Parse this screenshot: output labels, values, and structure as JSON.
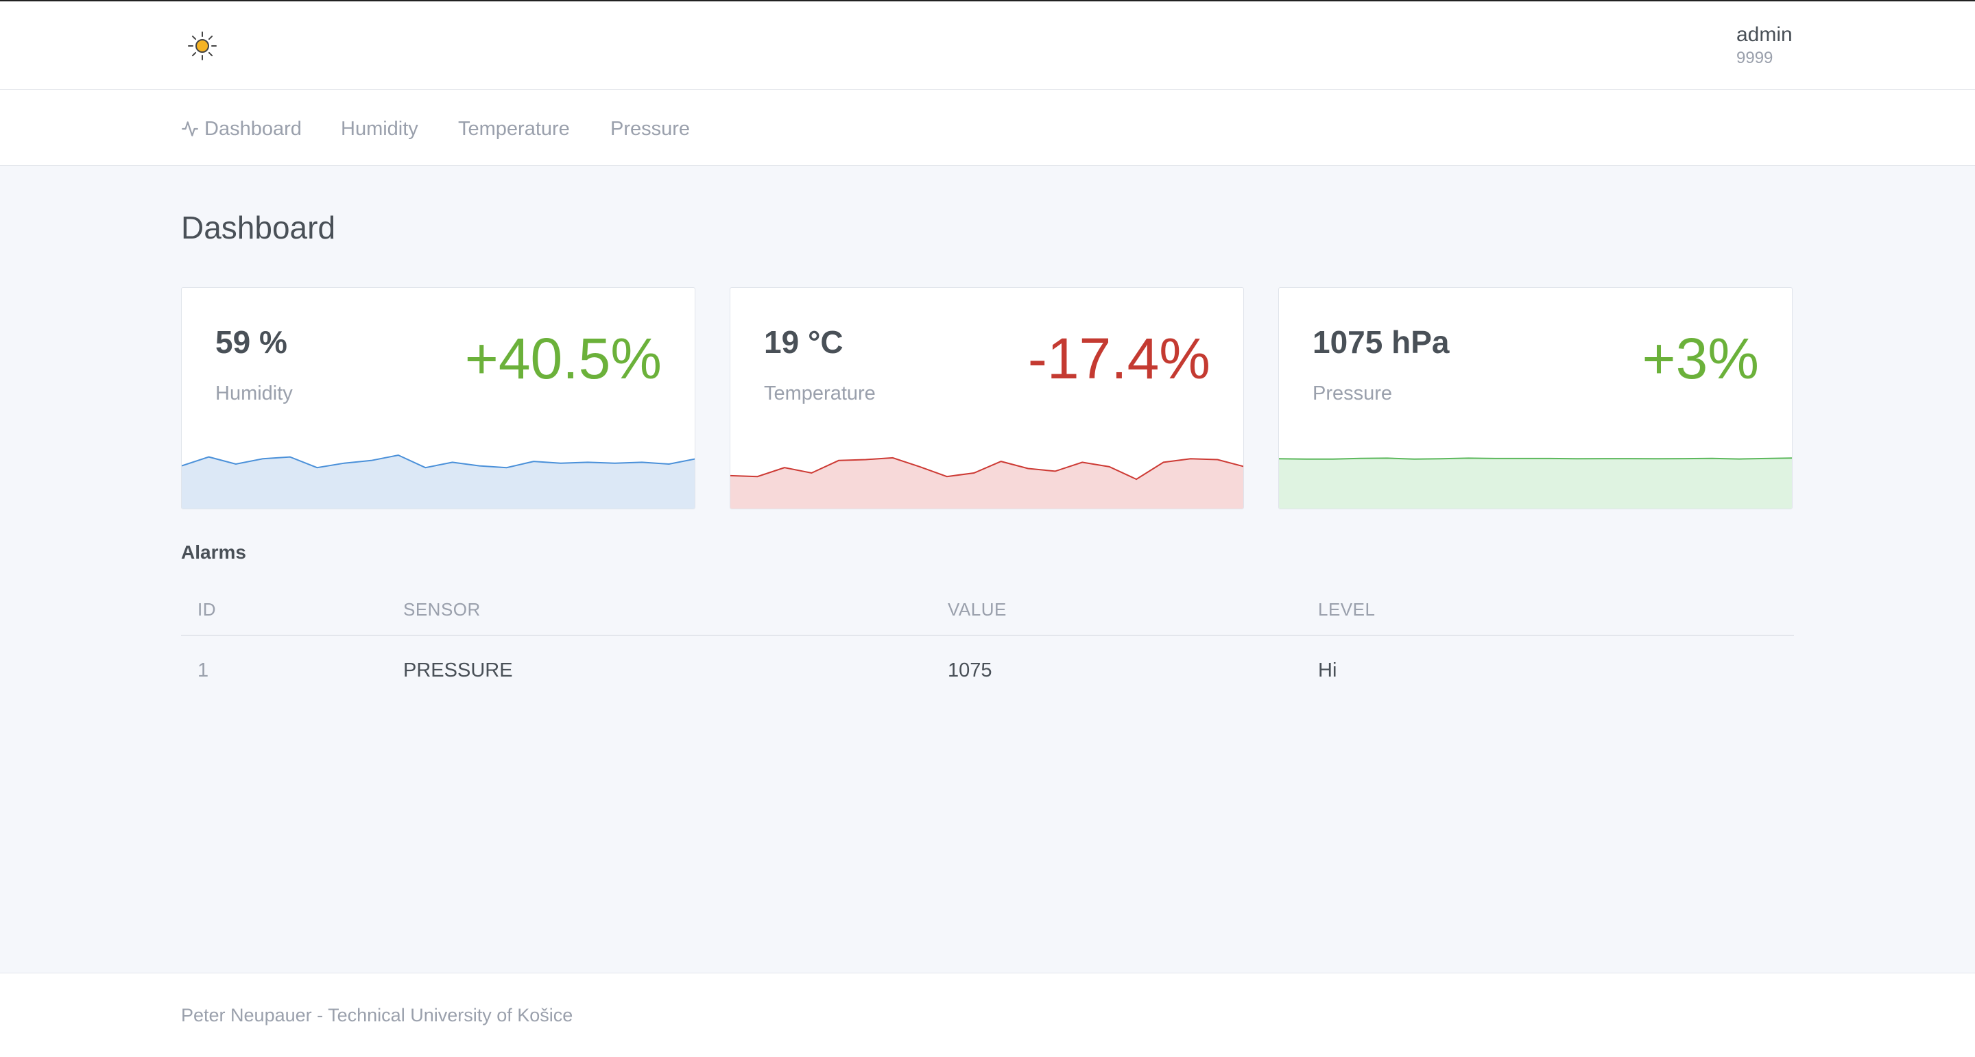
{
  "header": {
    "logo_icon": "sun-icon",
    "user": {
      "name": "admin",
      "id": "9999"
    }
  },
  "nav": {
    "items": [
      {
        "label": "Dashboard",
        "icon": "activity-icon"
      },
      {
        "label": "Humidity"
      },
      {
        "label": "Temperature"
      },
      {
        "label": "Pressure"
      }
    ]
  },
  "page": {
    "title": "Dashboard"
  },
  "cards": [
    {
      "value": "59 %",
      "label": "Humidity",
      "change": "+40.5%",
      "change_color": "#6bb13a",
      "line_color": "#4a90d9",
      "fill_color": "#dce8f6",
      "series": [
        48,
        58,
        50,
        56,
        58,
        46,
        51,
        54,
        60,
        46,
        52,
        48,
        46,
        53,
        51,
        52,
        51,
        52,
        50,
        56
      ]
    },
    {
      "value": "19 °C",
      "label": "Temperature",
      "change": "-17.4%",
      "change_color": "#c43a31",
      "line_color": "#cd3a34",
      "fill_color": "#f7d9d9",
      "series": [
        37,
        36,
        46,
        40,
        54,
        55,
        57,
        47,
        36,
        40,
        53,
        45,
        42,
        52,
        47,
        33,
        52,
        56,
        55,
        47
      ]
    },
    {
      "value": "1075 hPa",
      "label": "Pressure",
      "change": "+3%",
      "change_color": "#6bb13a",
      "line_color": "#5cb85c",
      "fill_color": "#dff3e1",
      "series": [
        56,
        55.6,
        55.6,
        56.4,
        56.6,
        55.5,
        56,
        56.6,
        56.2,
        56.2,
        56.2,
        55.9,
        56.1,
        56.1,
        56,
        56.1,
        56.3,
        55.7,
        56.2,
        56.8
      ]
    }
  ],
  "alarms": {
    "title": "Alarms",
    "columns": [
      "ID",
      "SENSOR",
      "VALUE",
      "LEVEL"
    ],
    "rows": [
      [
        "1",
        "PRESSURE",
        "1075",
        "Hi"
      ]
    ]
  },
  "footer": {
    "text": "Peter Neupauer - Technical University of Košice"
  }
}
